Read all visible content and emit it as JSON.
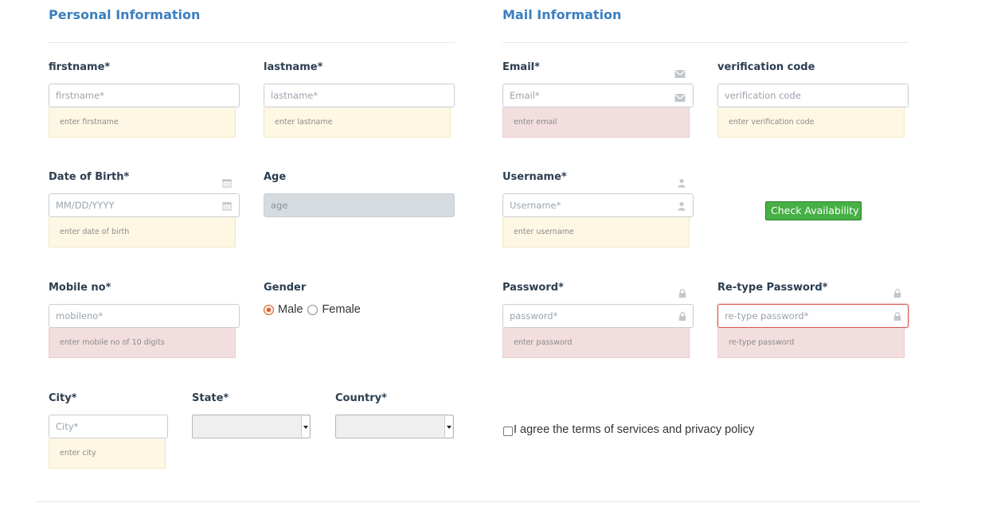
{
  "personal": {
    "title": "Personal Information",
    "firstname": {
      "label": "firstname*",
      "placeholder": "firstname*",
      "hint": "enter firstname"
    },
    "lastname": {
      "label": "lastname*",
      "placeholder": "lastname*",
      "hint": "enter lastname"
    },
    "dob": {
      "label": "Date of Birth*",
      "placeholder": "MM/DD/YYYY",
      "hint": "enter date of birth"
    },
    "age": {
      "label": "Age",
      "placeholder": "age"
    },
    "mobile": {
      "label": "Mobile no*",
      "placeholder": "mobileno*",
      "hint": "enter mobile no of 10 digits"
    },
    "gender": {
      "label": "Gender",
      "options": [
        "Male",
        "Female"
      ],
      "selected": "Male"
    },
    "city": {
      "label": "City*",
      "placeholder": "City*",
      "hint": "enter city"
    },
    "state": {
      "label": "State*",
      "value": ""
    },
    "country": {
      "label": "Country*",
      "value": ""
    }
  },
  "mail": {
    "title": "Mail Information",
    "email": {
      "label": "Email*",
      "placeholder": "Email*",
      "hint": "enter email"
    },
    "verification": {
      "label": "verification code",
      "placeholder": "verification code",
      "hint": "enter verification code"
    },
    "username": {
      "label": "Username*",
      "placeholder": "Username*",
      "hint": "enter username"
    },
    "check_availability": "Check Availability",
    "password": {
      "label": "Password*",
      "placeholder": "password*",
      "hint": "enter password"
    },
    "retype": {
      "label": "Re-type Password*",
      "placeholder": "re-type password*",
      "hint": "re-type password"
    },
    "terms": {
      "label": "I agree the terms of services and privacy policy",
      "checked": false
    }
  },
  "colors": {
    "accent": "#3a7fc1",
    "warn_bg": "#fdf7e3",
    "error_bg": "#f2dede",
    "button_green": "#46b045"
  },
  "icons": [
    "calendar-icon",
    "envelope-icon",
    "user-icon",
    "lock-icon"
  ]
}
